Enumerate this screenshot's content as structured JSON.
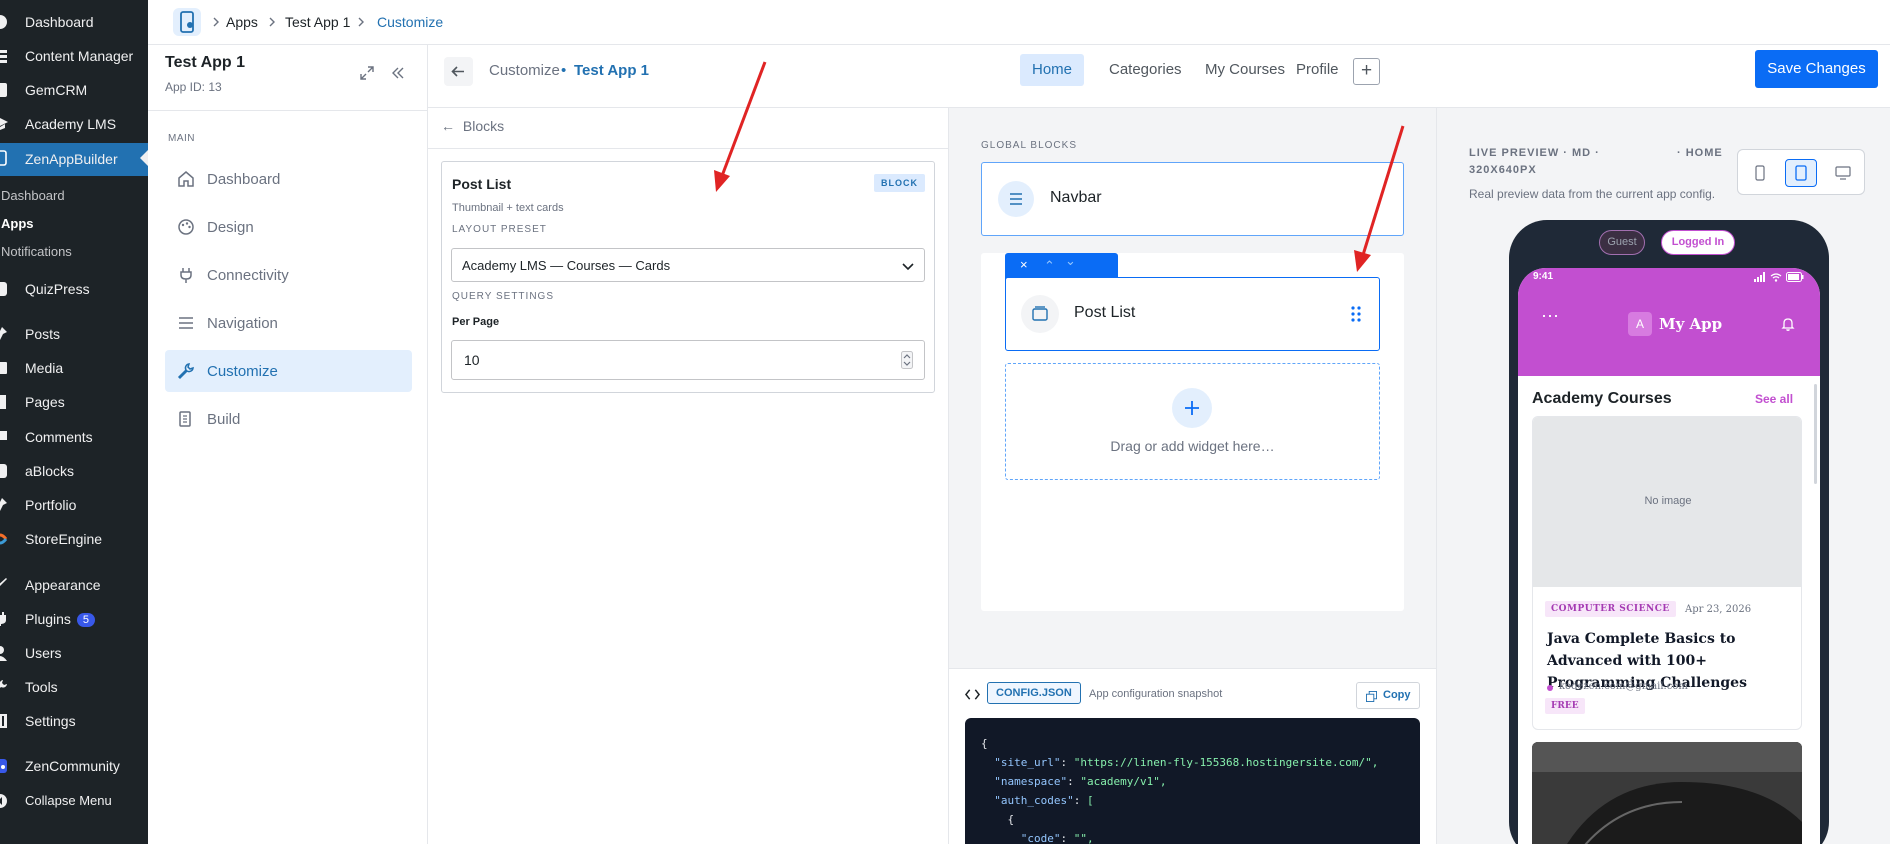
{
  "wp_menu": {
    "items": [
      {
        "label": "Dashboard",
        "icon": "gauge-icon"
      },
      {
        "label": "Content Manager",
        "icon": "content-manager-icon"
      },
      {
        "label": "GemCRM",
        "icon": "gemcrm-icon"
      },
      {
        "label": "Academy LMS",
        "icon": "graduation-cap-icon"
      },
      {
        "label": "ZenAppBuilder",
        "icon": "zenappbuilder-icon"
      },
      {
        "label": "QuizPress",
        "icon": "quizpress-icon"
      },
      {
        "label": "Posts",
        "icon": "pin-icon"
      },
      {
        "label": "Media",
        "icon": "media-icon"
      },
      {
        "label": "Pages",
        "icon": "pages-icon"
      },
      {
        "label": "Comments",
        "icon": "comment-icon"
      },
      {
        "label": "aBlocks",
        "icon": "ablocks-icon"
      },
      {
        "label": "Portfolio",
        "icon": "pin-icon"
      },
      {
        "label": "StoreEngine",
        "icon": "storeengine-icon"
      },
      {
        "label": "Appearance",
        "icon": "brush-icon"
      },
      {
        "label": "Plugins",
        "icon": "plug-icon",
        "badge": "5"
      },
      {
        "label": "Users",
        "icon": "user-icon"
      },
      {
        "label": "Tools",
        "icon": "wrench-icon"
      },
      {
        "label": "Settings",
        "icon": "settings-icon"
      },
      {
        "label": "ZenCommunity",
        "icon": "community-icon"
      },
      {
        "label": "Collapse Menu",
        "icon": "collapse-icon"
      }
    ],
    "submenu": [
      "Dashboard",
      "Apps",
      "Notifications"
    ]
  },
  "breadcrumb": {
    "items": [
      "Apps",
      "Test App 1",
      "Customize"
    ]
  },
  "app": {
    "name": "Test App 1",
    "id_label": "App ID: 13"
  },
  "app_nav": {
    "section_label": "MAIN",
    "items": [
      {
        "label": "Dashboard",
        "icon": "home-icon"
      },
      {
        "label": "Design",
        "icon": "palette-icon"
      },
      {
        "label": "Connectivity",
        "icon": "plug-icon"
      },
      {
        "label": "Navigation",
        "icon": "menu-icon"
      },
      {
        "label": "Customize",
        "icon": "wrench-icon"
      },
      {
        "label": "Build",
        "icon": "build-icon"
      }
    ]
  },
  "customize_header": {
    "title": "Customize",
    "separator": "•",
    "app_name": "Test App 1",
    "tabs": [
      "Home",
      "Categories",
      "My Courses",
      "Profile"
    ],
    "add_label": "+",
    "save_label": "Save Changes"
  },
  "blocks_panel": {
    "back_label": "Blocks",
    "block": {
      "title": "Post List",
      "badge": "BLOCK",
      "subtitle": "Thumbnail + text cards",
      "layout_label": "LAYOUT PRESET",
      "layout_value": "Academy LMS — Courses — Cards",
      "query_label": "QUERY SETTINGS",
      "per_page_label": "Per Page",
      "per_page_value": "10"
    }
  },
  "canvas": {
    "global_label": "GLOBAL BLOCKS",
    "navbar_label": "Navbar",
    "post_list_label": "Post List",
    "drop_label": "Drag or add widget here…",
    "toolbar_close": "×",
    "toolbar_up": "⌃",
    "toolbar_down": "⌄"
  },
  "config": {
    "badge": "CONFIG.JSON",
    "caption": "App configuration snapshot",
    "copy_label": "Copy",
    "code_lines": [
      "{",
      "  \"site_url\": \"https://linen-fly-155368.hostingersite.com/\",",
      "  \"namespace\": \"academy/v1\",",
      "  \"auth_codes\": [",
      "    {",
      "      \"code\": \"\","
    ]
  },
  "preview": {
    "label_line1": "LIVE PREVIEW · MD ·",
    "label_line2": "320X640PX",
    "screen": "· HOME",
    "description": "Real preview data from the current app config.",
    "guest": "Guest",
    "logged_in": "Logged In",
    "time": "9:41",
    "app_initial": "A",
    "app_title": "My App",
    "section_title": "Academy Courses",
    "see_all": "See all",
    "no_image": "No image",
    "course_category": "COMPUTER SCIENCE",
    "course_date": "Apr 23, 2026",
    "course_title": "Java Complete Basics to Advanced with 100+ Programming Challenges",
    "course_author": "kodezen.com@gmail.com",
    "course_price": "FREE",
    "accent": "#c24fd0"
  },
  "colors": {
    "primary": "#2271b1",
    "save": "#0a6cf5",
    "arrow": "#e02424"
  }
}
